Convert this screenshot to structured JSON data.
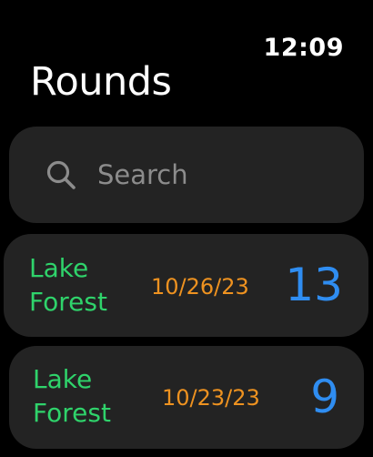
{
  "status": {
    "time": "12:09"
  },
  "header": {
    "title": "Rounds"
  },
  "search": {
    "placeholder": "Search",
    "icon": "search-icon"
  },
  "colors": {
    "background": "#000000",
    "card": "#232323",
    "course": "#2fd36b",
    "date": "#ee9220",
    "score": "#2f8df1",
    "placeholder": "#8c8c8c"
  },
  "rounds": [
    {
      "course": "Lake Forest",
      "date": "10/26/23",
      "score": "13"
    },
    {
      "course": "Lake Forest",
      "date": "10/23/23",
      "score": "9"
    }
  ]
}
